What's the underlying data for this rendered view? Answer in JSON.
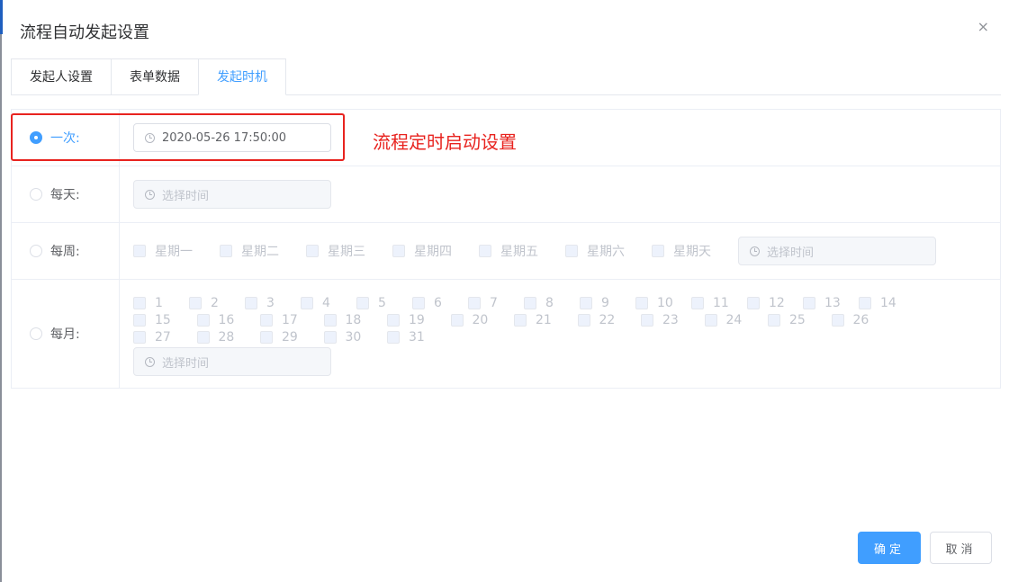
{
  "dialog": {
    "title": "流程自动发起设置",
    "close_icon": "×"
  },
  "tabs": [
    {
      "label": "发起人设置",
      "active": false
    },
    {
      "label": "表单数据",
      "active": false
    },
    {
      "label": "发起时机",
      "active": true
    }
  ],
  "rows": {
    "once": {
      "label": "一次:",
      "checked": true,
      "time_value": "2020-05-26 17:50:00"
    },
    "daily": {
      "label": "每天:",
      "checked": false,
      "placeholder": "选择时间"
    },
    "weekly": {
      "label": "每周:",
      "checked": false,
      "placeholder": "选择时间",
      "days": [
        "星期一",
        "星期二",
        "星期三",
        "星期四",
        "星期五",
        "星期六",
        "星期天"
      ]
    },
    "monthly": {
      "label": "每月:",
      "checked": false,
      "placeholder": "选择时间",
      "days": [
        "1",
        "2",
        "3",
        "4",
        "5",
        "6",
        "7",
        "8",
        "9",
        "10",
        "11",
        "12",
        "13",
        "14",
        "15",
        "16",
        "17",
        "18",
        "19",
        "20",
        "21",
        "22",
        "23",
        "24",
        "25",
        "26",
        "27",
        "28",
        "29",
        "30",
        "31"
      ]
    }
  },
  "annotation": {
    "text": "流程定时启动设置",
    "color": "#e8231f"
  },
  "footer": {
    "confirm_label": "确定",
    "cancel_label": "取消"
  },
  "colors": {
    "primary": "#409eff",
    "annotation": "#e8231f"
  }
}
